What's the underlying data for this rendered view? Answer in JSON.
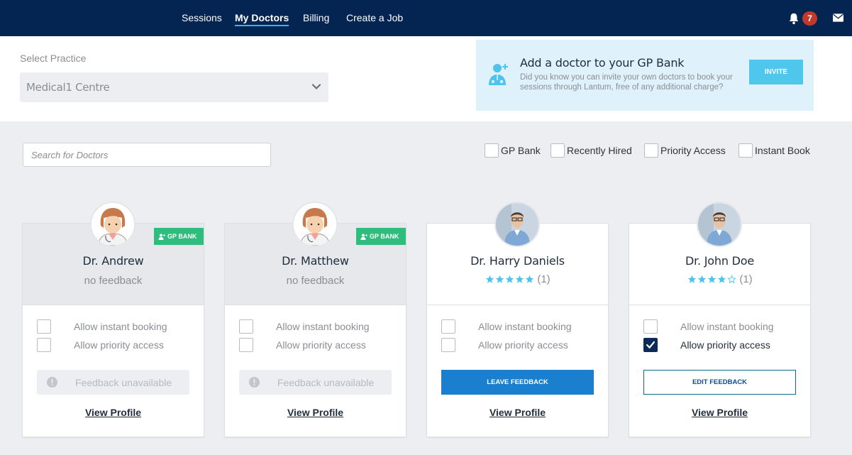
{
  "nav": {
    "links": [
      {
        "label": "Sessions"
      },
      {
        "label": "My Doctors"
      },
      {
        "label": "Billing"
      },
      {
        "label": "Create a Job"
      }
    ],
    "notification_count": "7"
  },
  "practice": {
    "label": "Select Practice",
    "selected": "Medical1 Centre"
  },
  "invite": {
    "title": "Add a doctor to your GP Bank",
    "description": "Did you know you can invite your own doctors to book your sessions through Lantum, free of any additional charge?",
    "button": "INVITE"
  },
  "search": {
    "placeholder": "Search for Doctors",
    "value": ""
  },
  "filters": [
    {
      "label": "GP Bank",
      "checked": false
    },
    {
      "label": "Recently Hired",
      "checked": false
    },
    {
      "label": "Priority Access",
      "checked": false
    },
    {
      "label": "Instant Book",
      "checked": false
    }
  ],
  "colors": {
    "nav_bg": "#042452",
    "gp_badge": "#2ebd7c",
    "star": "#4fc3ec",
    "leave_feedback": "#1a7fcf",
    "checked": "#0c2a57"
  },
  "doctors": [
    {
      "name": "Dr. Andrew",
      "badge": "GP BANK",
      "feedback_text": "no feedback",
      "options": [
        {
          "label": "Allow instant booking",
          "checked": false
        },
        {
          "label": "Allow priority access",
          "checked": false
        }
      ],
      "action": "Feedback unavailable",
      "view_profile": "View Profile"
    },
    {
      "name": "Dr. Matthew",
      "badge": "GP BANK",
      "feedback_text": "no feedback",
      "options": [
        {
          "label": "Allow instant booking",
          "checked": false
        },
        {
          "label": "Allow priority access",
          "checked": false
        }
      ],
      "action": "Feedback unavailable",
      "view_profile": "View Profile"
    },
    {
      "name": "Dr. Harry Daniels",
      "rating": 5,
      "rating_count": "(1)",
      "options": [
        {
          "label": "Allow instant booking",
          "checked": false
        },
        {
          "label": "Allow priority access",
          "checked": false
        }
      ],
      "action": "LEAVE FEEDBACK",
      "view_profile": "View Profile"
    },
    {
      "name": "Dr. John Doe",
      "rating": 4,
      "rating_count": "(1)",
      "options": [
        {
          "label": "Allow instant booking",
          "checked": false
        },
        {
          "label": "Allow priority access",
          "checked": true
        }
      ],
      "action": "EDIT FEEDBACK",
      "view_profile": "View Profile"
    }
  ]
}
